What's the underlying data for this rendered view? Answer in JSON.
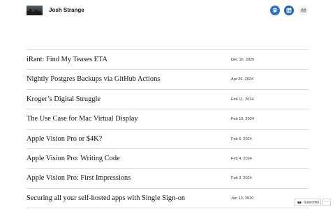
{
  "header": {
    "site_title": "Josh Strange",
    "social": [
      {
        "name": "mastodon-icon",
        "color": "#2f6fdb"
      },
      {
        "name": "linkedin-icon",
        "color": "#1a61c4"
      },
      {
        "name": "mail-icon",
        "color": "#f1f2f4"
      }
    ]
  },
  "posts": [
    {
      "title": "iRant: Find My Teases ETA",
      "date": "Dec 16, 2025"
    },
    {
      "title": "Nightly Postgres Backups via GitHub Actions",
      "date": "Apr 26, 2024"
    },
    {
      "title": "Kroger’s Digital Struggle",
      "date": "Feb 11, 2024"
    },
    {
      "title": "The Use Case for Mac Virtual Display",
      "date": "Feb 10, 2024"
    },
    {
      "title": "Apple Vision Pro or $4K?",
      "date": "Feb 5, 2024"
    },
    {
      "title": "Apple Vision Pro: Writing Code",
      "date": "Feb 4, 2024"
    },
    {
      "title": "Apple Vision Pro: First Impressions",
      "date": "Feb 3, 2024"
    },
    {
      "title": "Securing all your self-hosted apps with Single Sign-on",
      "date": "Jan 13, 2020"
    }
  ],
  "footer_bar": {
    "subscribe_label": "Subscribe",
    "more_label": "···"
  },
  "colors": {
    "divider": "#d9d9d9",
    "text": "#111111",
    "accent": "#1a61c4"
  }
}
